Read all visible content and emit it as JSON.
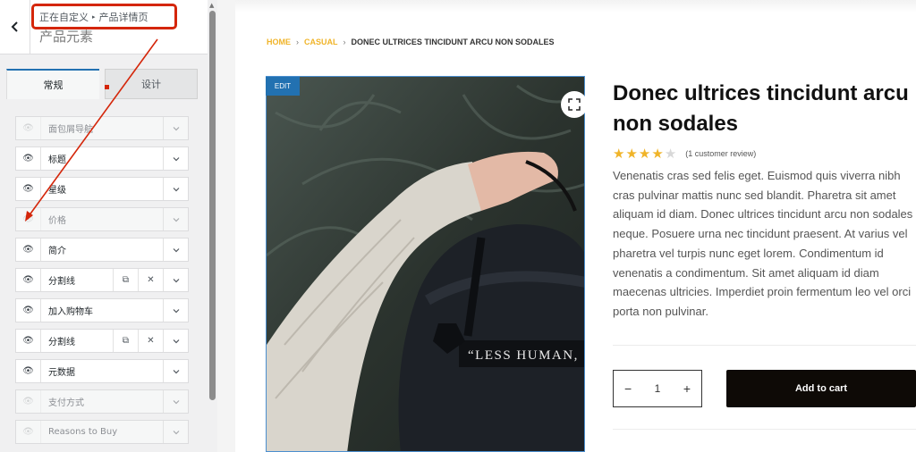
{
  "sidebar": {
    "breadcrumb": {
      "parent": "正在自定义",
      "current": "产品详情页"
    },
    "section_title": "产品元素",
    "tabs": {
      "general": "常规",
      "design": "设计"
    },
    "items": [
      {
        "label": "面包屑导航",
        "enabled": false
      },
      {
        "label": "标题",
        "enabled": true
      },
      {
        "label": "星级",
        "enabled": true
      },
      {
        "label": "价格",
        "enabled": false
      },
      {
        "label": "简介",
        "enabled": true
      },
      {
        "label": "分割线",
        "enabled": true,
        "has_duplicate": true,
        "has_remove": true
      },
      {
        "label": "加入购物车",
        "enabled": true
      },
      {
        "label": "分割线",
        "enabled": true,
        "has_duplicate": true,
        "has_remove": true
      },
      {
        "label": "元数据",
        "enabled": true
      },
      {
        "label": "支付方式",
        "enabled": false
      },
      {
        "label": "Reasons to Buy",
        "enabled": false
      }
    ],
    "accent_color": "#2271b1",
    "annotation_color": "#d4260a"
  },
  "preview": {
    "breadcrumb": {
      "home": "HOME",
      "category": "CASUAL",
      "current": "DONEC ULTRICES TINCIDUNT ARCU NON SODALES"
    },
    "edit_badge": "EDIT",
    "product_title": "Donec ultrices tincidunt arcu non sodales",
    "rating": {
      "value": 4,
      "max": 5,
      "star_color": "#f0b429"
    },
    "review_text": "(1 customer review)",
    "description": "Venenatis cras sed felis eget. Euismod quis viverra nibh cras pulvinar mattis nunc sed blandit. Pharetra sit amet aliquam id diam. Donec ultrices tincidunt arcu non sodales neque. Posuere urna nec tincidunt praesent. At varius vel pharetra vel turpis nunc eget lorem. Condimentum id venenatis a condimentum. Sit amet aliquam id diam maecenas ultricies. Imperdiet proin fermentum leo vel orci porta non pulvinar.",
    "image_caption": "“LESS HUMAN,",
    "quantity": {
      "minus": "−",
      "value": "1",
      "plus": "+"
    },
    "add_to_cart": "Add to cart",
    "accent_color": "#f0b429"
  }
}
